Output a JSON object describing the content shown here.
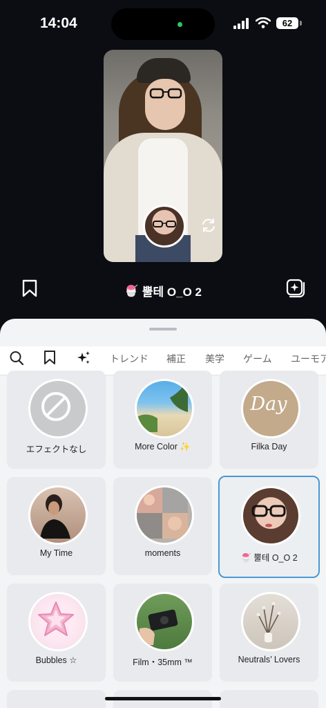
{
  "status": {
    "time": "14:04",
    "battery": "62"
  },
  "effect": {
    "emoji": "🍧",
    "name": "뿔테 O_O 2"
  },
  "tabs": [
    "トレンド",
    "補正",
    "美学",
    "ゲーム",
    "ユーモア"
  ],
  "effects": [
    {
      "label": "エフェクトなし",
      "thumb": "none-icon"
    },
    {
      "label": "More Color ✨",
      "thumb": "beach"
    },
    {
      "label": "Filka Day",
      "thumb": "day-script",
      "thumb_text": "Day"
    },
    {
      "label": "My Time",
      "thumb": "portrait-dark"
    },
    {
      "label": "moments",
      "thumb": "collage"
    },
    {
      "label": "🍧 뿔테 O_O 2",
      "thumb": "glasses-face",
      "selected": true
    },
    {
      "label": "Bubbles ☆",
      "thumb": "star"
    },
    {
      "label": "Film・35mm ™",
      "thumb": "camera"
    },
    {
      "label": "Neutrals’ Lovers",
      "thumb": "branches"
    }
  ],
  "colors": {
    "accent": "#4a98d6",
    "sheet": "#f3f4f6",
    "tile": "#e9eaed"
  }
}
